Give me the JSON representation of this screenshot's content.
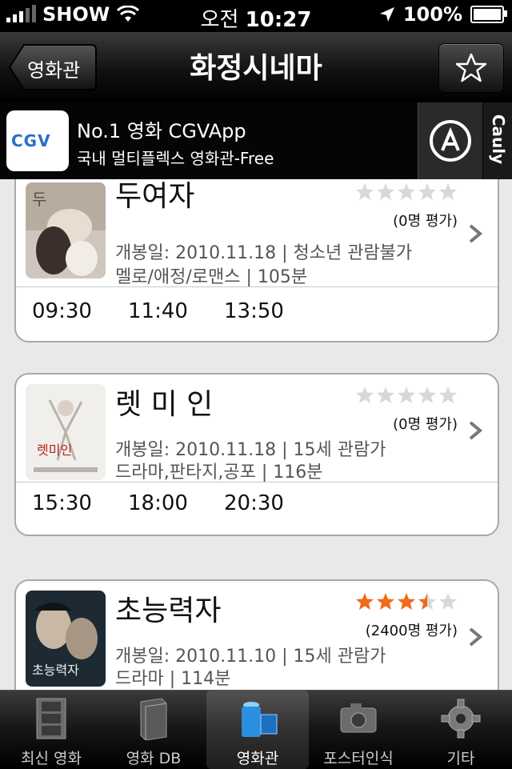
{
  "status_bar": {
    "carrier": "SHOW",
    "time_prefix": "오전",
    "time": "10:27",
    "battery": "100%"
  },
  "nav": {
    "back_label": "영화관",
    "title": "화정시네마"
  },
  "ad": {
    "logo_text": "CGV",
    "line1": "No.1 영화 CGVApp",
    "line2": "국내 멀티플렉스 영화관-Free",
    "brand": "Cauly"
  },
  "movies": [
    {
      "title": "두여자",
      "rating_count": "(0명 평가)",
      "stars": 0,
      "info1": "개봉일: 2010.11.18 | 청소년 관람불가",
      "info2": "멜로/애정/로맨스 | 105분",
      "times": [
        "09:30",
        "11:40",
        "13:50"
      ]
    },
    {
      "title": "렛 미 인",
      "rating_count": "(0명 평가)",
      "stars": 0,
      "info1": "개봉일: 2010.11.18 | 15세 관람가",
      "info2": "드라마,판타지,공포 | 116분",
      "times": [
        "15:30",
        "18:00",
        "20:30"
      ]
    },
    {
      "title": "초능력자",
      "rating_count": "(2400명 평가)",
      "stars": 3.5,
      "info1": "개봉일: 2010.11.10 | 15세 관람가",
      "info2": "드라마 | 114분",
      "times": []
    }
  ],
  "tabs": [
    {
      "label": "최신 영화",
      "icon": "film-strip-icon"
    },
    {
      "label": "영화 DB",
      "icon": "book-icon"
    },
    {
      "label": "영화관",
      "icon": "cinema-icon"
    },
    {
      "label": "포스터인식",
      "icon": "camera-icon"
    },
    {
      "label": "기타",
      "icon": "gear-icon"
    }
  ],
  "colors": {
    "star_on": "#f26a1b",
    "star_off": "#d8d8d8",
    "accent_blue": "#2b6ec7"
  }
}
